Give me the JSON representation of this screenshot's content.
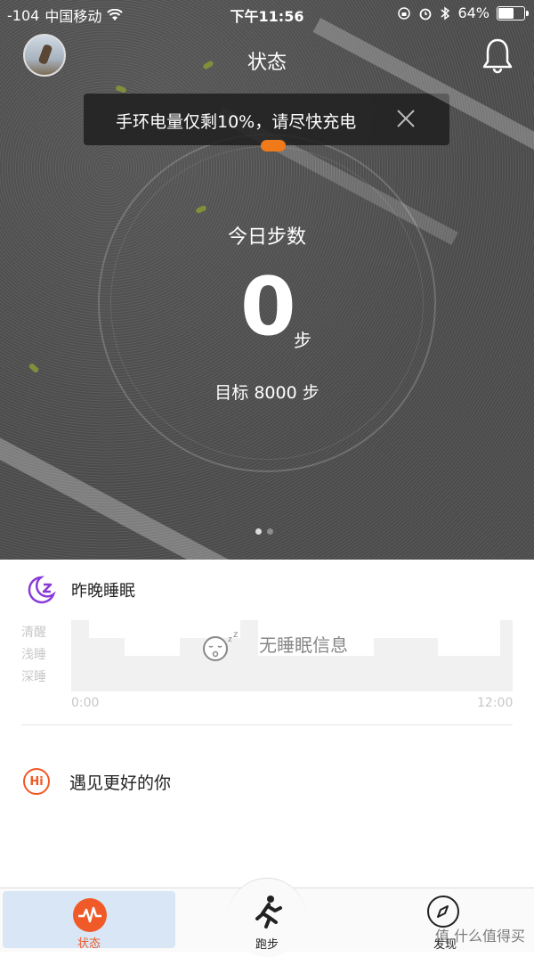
{
  "status_bar": {
    "signal": "-104",
    "carrier": "中国移动",
    "time": "下午11:56",
    "battery": "64%",
    "battery_level": 0.64
  },
  "header": {
    "title": "状态"
  },
  "toast": {
    "message": "手环电量仅剩10%，请尽快充电"
  },
  "steps": {
    "label": "今日步数",
    "value": "0",
    "unit": "步",
    "goal": "目标 8000 步"
  },
  "sleep": {
    "title": "昨晚睡眠",
    "levels": [
      "清醒",
      "浅睡",
      "深睡"
    ],
    "empty_message": "无睡眠信息",
    "time_start": "0:00",
    "time_end": "12:00"
  },
  "hi": {
    "icon_text": "Hi",
    "text": "遇见更好的你"
  },
  "tabs": [
    {
      "label": "状态",
      "active": true
    },
    {
      "label": "跑步",
      "active": false
    },
    {
      "label": "发现",
      "active": false
    }
  ],
  "watermark": "值 什么值得买",
  "colors": {
    "accent": "#f05a28",
    "toast_bg": "#1e1e1e",
    "sleep_icon": "#8a3ad6"
  }
}
